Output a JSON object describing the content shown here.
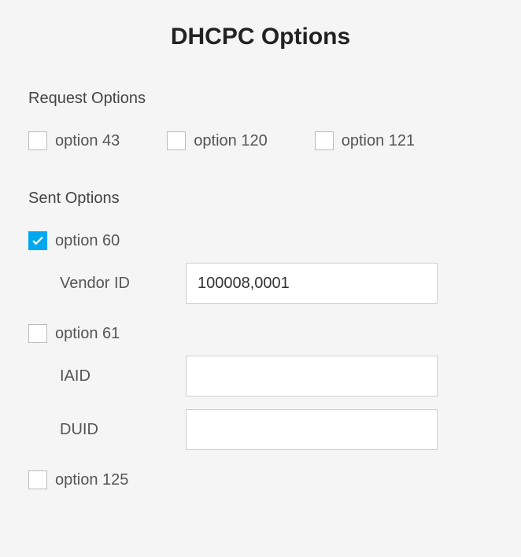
{
  "title": "DHCPC Options",
  "request_options": {
    "header": "Request Options",
    "items": [
      {
        "label": "option 43",
        "checked": false
      },
      {
        "label": "option 120",
        "checked": false
      },
      {
        "label": "option 121",
        "checked": false
      }
    ]
  },
  "sent_options": {
    "header": "Sent Options",
    "option60": {
      "label": "option 60",
      "checked": true,
      "vendor_id_label": "Vendor ID",
      "vendor_id_value": "100008,0001"
    },
    "option61": {
      "label": "option 61",
      "checked": false,
      "iaid_label": "IAID",
      "iaid_value": "",
      "duid_label": "DUID",
      "duid_value": ""
    },
    "option125": {
      "label": "option 125",
      "checked": false
    }
  }
}
